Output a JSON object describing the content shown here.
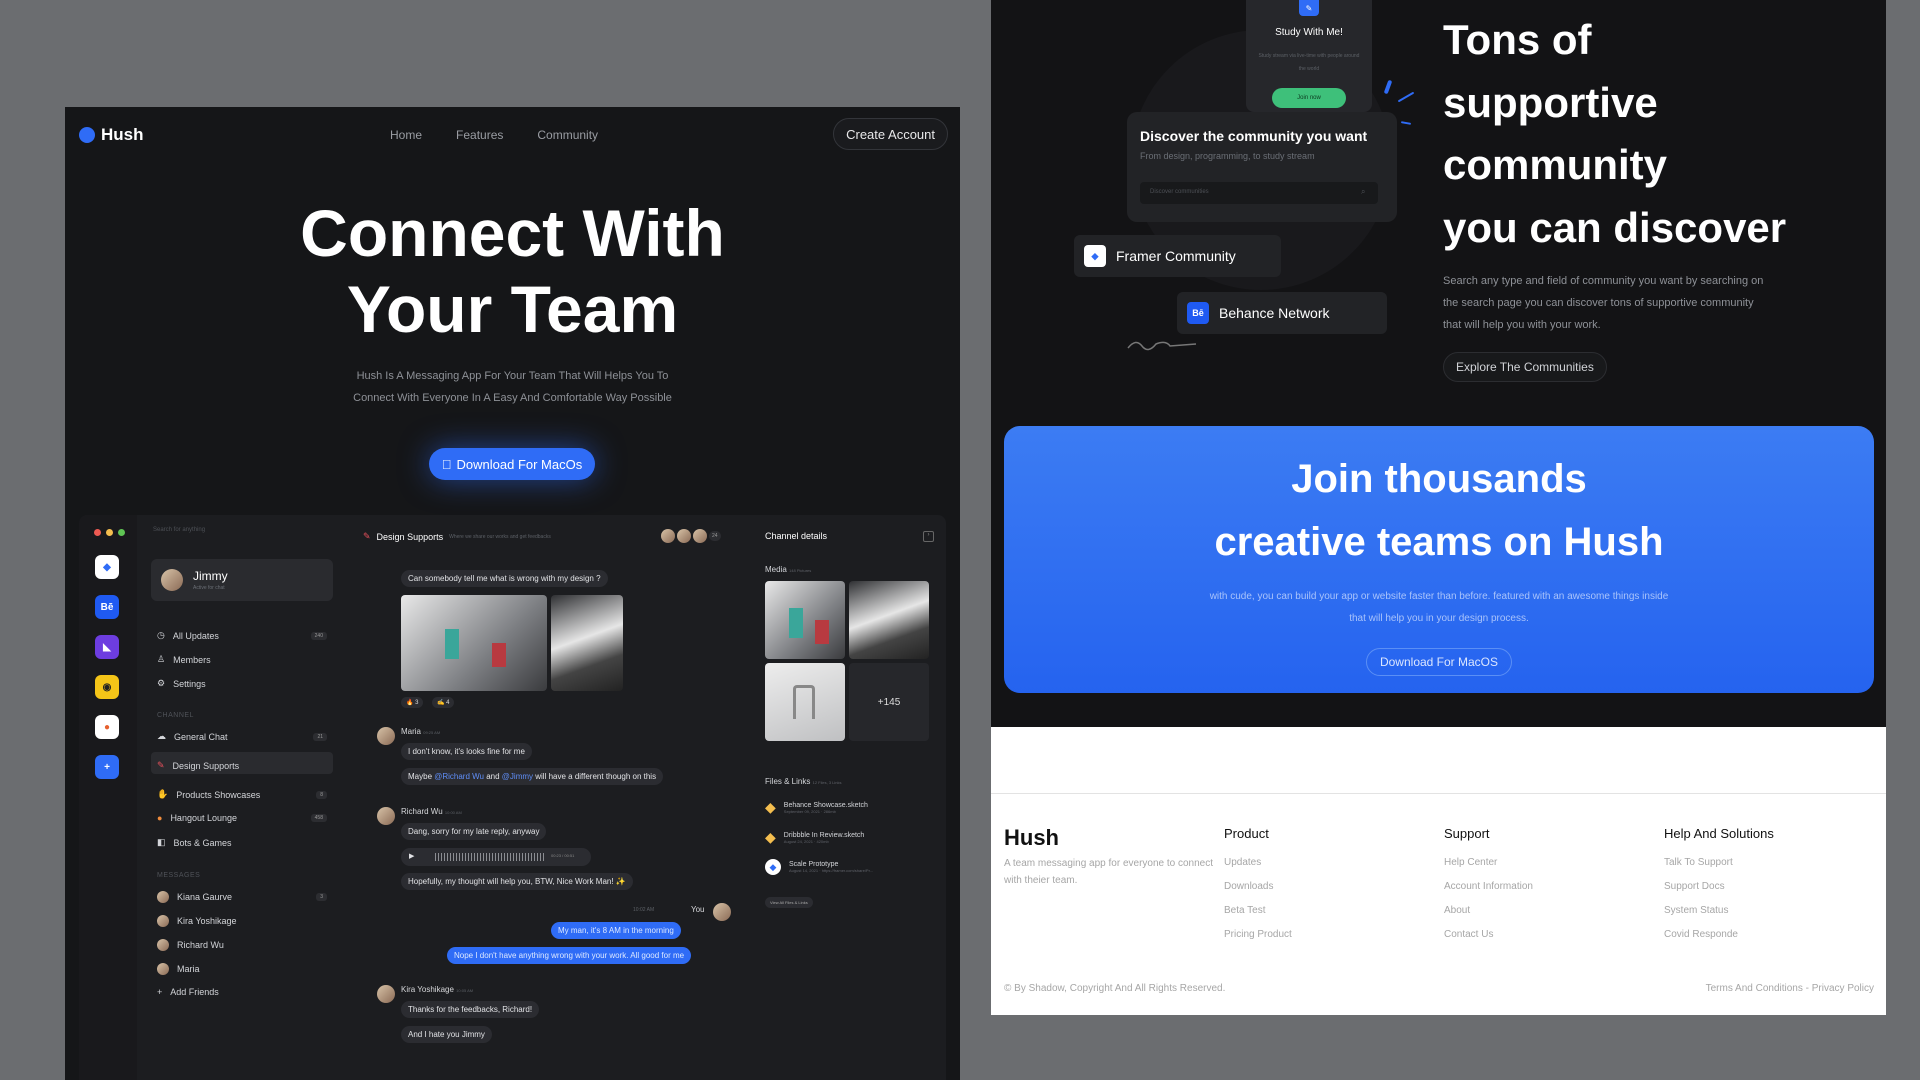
{
  "landing": {
    "logo": "Hush",
    "nav": [
      "Home",
      "Features",
      "Community"
    ],
    "create_account": "Create Account",
    "hero_title_1": "Connect With",
    "hero_title_2": "Your Team",
    "hero_subtitle": "Hush Is A Messaging App For Your Team That Will Helps You To Connect With Everyone In A Easy And Comfortable Way Possible",
    "download_label": "Download For MacOs"
  },
  "app": {
    "search_placeholder": "Search for anything",
    "user": {
      "name": "Jimmy",
      "status": "Active for chat"
    },
    "menu": [
      {
        "label": "All Updates",
        "icon": "clock-icon",
        "count": "240"
      },
      {
        "label": "Members",
        "icon": "user-icon",
        "count": ""
      },
      {
        "label": "Settings",
        "icon": "gear-icon",
        "count": ""
      }
    ],
    "channel_heading": "CHANNEL",
    "channels": [
      {
        "label": "General Chat",
        "count": "21"
      },
      {
        "label": "Design Supports",
        "count": ""
      },
      {
        "label": "Products Showcases",
        "count": "8"
      },
      {
        "label": "Hangout Lounge",
        "count": "458"
      },
      {
        "label": "Bots & Games",
        "count": ""
      }
    ],
    "messages_heading": "MESSAGES",
    "dms": [
      {
        "label": "Kiana Gaurve",
        "count": "3"
      },
      {
        "label": "Kira Yoshikage",
        "count": ""
      },
      {
        "label": "Richard Wu",
        "count": ""
      },
      {
        "label": "Maria",
        "count": ""
      }
    ],
    "add_friends": "Add Friends",
    "chat": {
      "channel": "Design Supports",
      "channel_desc": "Where we share our works and get feedbacks",
      "member_count": "24",
      "q": "Can somebody tell me what is wrong with my design ?",
      "reactions": [
        "🔥 3",
        "✍ 4"
      ],
      "maria": "Maria",
      "maria_time": "09:25 AM",
      "maria_1": "I don't know, it's looks fine for me",
      "maria_2_a": "Maybe ",
      "maria_2_b": "@Richard Wu",
      "maria_2_c": " and ",
      "maria_2_d": "@Jimmy",
      "maria_2_e": " will have a different though on this",
      "richard": "Richard Wu",
      "richard_time": "10:00 AM",
      "richard_1": "Dang, sorry for my late reply, anyway",
      "voice_time": "00:23 / 00:51",
      "richard_2": "Hopefully, my thought will help you, BTW, Nice Work Man! ✨",
      "me_time": "10:02 AM",
      "me_label": "You",
      "me_1": "My man, it's 8 AM in the morning",
      "me_2": "Nope I don't have anything wrong with your work. All good for me",
      "kira": "Kira Yoshikage",
      "kira_time": "10:05 AM",
      "kira_1": "Thanks for the feedbacks, Richard!",
      "kira_2": "And I hate you Jimmy"
    },
    "details": {
      "title": "Channel details",
      "media": "Media",
      "media_count": "148 Pictures",
      "more": "+145",
      "files_title": "Files & Links",
      "files_count": "12 Files, 3 Links",
      "files": [
        {
          "name": "Behance Showcase.sketch",
          "meta": "September 09, 2021 · 286mb"
        },
        {
          "name": "Dribbble In Review.sketch",
          "meta": "August 24, 2021 · 420mb"
        },
        {
          "name": "Scale Prototype",
          "meta": "August 14, 2021 · https://framer.com/share/Pr..."
        }
      ],
      "view_all": "View All Files & Links"
    }
  },
  "community": {
    "study_title": "Study With Me!",
    "study_desc": "Study stream via live-time with people around the world",
    "join_now": "Join now",
    "discover_title": "Discover the community you want",
    "discover_sub": "From design, programming, to study stream",
    "discover_placeholder": "Discover communities",
    "framer": "Framer Community",
    "behance": "Behance Network",
    "heading_lines": [
      "Tons of",
      "supportive",
      "community",
      "you can discover"
    ],
    "subtitle": "Search any type and field of community you want by searching on the search page you can discover tons of supportive community that will help you with your work.",
    "explore": "Explore The Communities"
  },
  "join": {
    "title_1": "Join thousands",
    "title_2": "creative teams on Hush",
    "subtitle": "with cude, you can build your app or website faster than before. featured with an awesome things inside that will help you in your design process.",
    "button": "Download For MacOS"
  },
  "footer": {
    "brand": "Hush",
    "desc": "A team messaging app for everyone to connect with theier team.",
    "cols": [
      {
        "title": "Product",
        "links": [
          "Updates",
          "Downloads",
          "Beta Test",
          "Pricing Product"
        ]
      },
      {
        "title": "Support",
        "links": [
          "Help Center",
          "Account Information",
          "About",
          "Contact Us"
        ]
      },
      {
        "title": "Help And Solutions",
        "links": [
          "Talk To Support",
          "Support Docs",
          "System Status",
          "Covid Responde"
        ]
      }
    ],
    "copyright": "© By Shadow, Copyright And All Rights Reserved.",
    "terms": "Terms And Conditions - Privacy Policy"
  },
  "colors": {
    "accent": "#2f6cf6",
    "background": "#151618",
    "success": "#3ec07a"
  }
}
